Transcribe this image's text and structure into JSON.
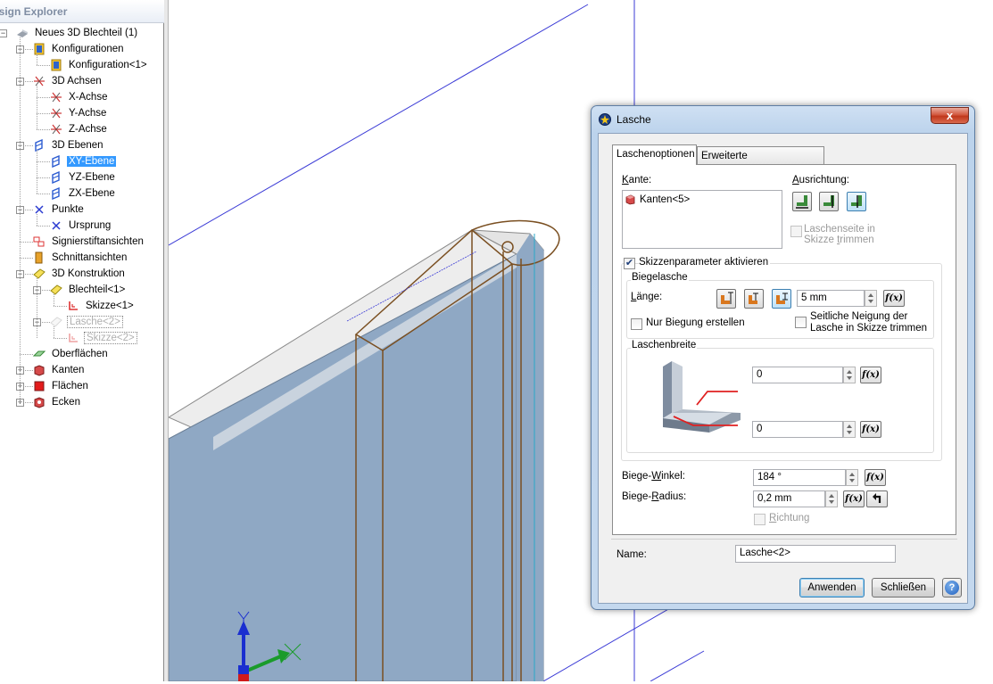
{
  "explorer": {
    "title": "esign Explorer",
    "items": [
      {
        "label": "Neues 3D Blechteil (1)",
        "icon": "sheetmetal-part-icon"
      },
      {
        "label": "Konfigurationen",
        "icon": "configurations-icon"
      },
      {
        "label": "Konfiguration<1>",
        "icon": "configuration-icon"
      },
      {
        "label": "3D Achsen",
        "icon": "axes-icon"
      },
      {
        "label": "X-Achse",
        "icon": "axis-icon"
      },
      {
        "label": "Y-Achse",
        "icon": "axis-icon"
      },
      {
        "label": "Z-Achse",
        "icon": "axis-icon"
      },
      {
        "label": "3D Ebenen",
        "icon": "planes-icon"
      },
      {
        "label": "XY-Ebene",
        "icon": "plane-icon"
      },
      {
        "label": "YZ-Ebene",
        "icon": "plane-icon"
      },
      {
        "label": "ZX-Ebene",
        "icon": "plane-icon"
      },
      {
        "label": "Punkte",
        "icon": "points-icon"
      },
      {
        "label": "Ursprung",
        "icon": "origin-icon"
      },
      {
        "label": "Signierstiftansichten",
        "icon": "marker-views-icon"
      },
      {
        "label": "Schnittansichten",
        "icon": "section-views-icon"
      },
      {
        "label": "3D Konstruktion",
        "icon": "construction-icon"
      },
      {
        "label": "Blechteil<1>",
        "icon": "sheetmetal-icon"
      },
      {
        "label": "Skizze<1>",
        "icon": "sketch-icon"
      },
      {
        "label": "Lasche<2>",
        "icon": "flange-icon"
      },
      {
        "label": "Skizze<2>",
        "icon": "sketch-icon"
      },
      {
        "label": "Oberflächen",
        "icon": "surfaces-icon"
      },
      {
        "label": "Kanten",
        "icon": "edges-icon"
      },
      {
        "label": "Flächen",
        "icon": "faces-icon"
      },
      {
        "label": "Ecken",
        "icon": "corners-icon"
      }
    ]
  },
  "dialog": {
    "title": "Lasche",
    "close_label": "x",
    "tabs": [
      "Laschenoptionen",
      "Erweiterte Laschenoptionen"
    ],
    "kante": {
      "label_pre": "K",
      "label_post": "ante:",
      "items": [
        "Kanten<5>"
      ]
    },
    "ausrichtung": {
      "label_pre": "A",
      "label_post": "usrichtung:",
      "trim_line1": "Laschenseite in",
      "trim_line2_pre": "Skizze ",
      "trim_line2_u": "t",
      "trim_line2_post": "rimmen"
    },
    "skizzen_param": {
      "label": "Skizzenparameter aktivieren",
      "checked": true
    },
    "biegelasche": {
      "title": "Biegelasche",
      "laenge_pre": "L",
      "laenge_post": "änge:",
      "laenge_value": "5 mm",
      "nur_biegung": "Nur Biegung erstellen",
      "seitliche_line1": "Seitliche Neigung der",
      "seitliche_line2": "Lasche in Skizze trimmen"
    },
    "laschenbreite": {
      "title": "Laschenbreite",
      "value1": "0",
      "value2": "0"
    },
    "biege_winkel": {
      "label_pre": "Biege-",
      "label_u": "W",
      "label_post": "inkel:",
      "value": "184 °"
    },
    "biege_radius": {
      "label_pre": "Biege-",
      "label_u": "R",
      "label_post": "adius:",
      "value": "0,2 mm"
    },
    "richtung": {
      "label_u": "R",
      "label_post": "ichtung"
    },
    "name": {
      "label": "Name:",
      "value": "Lasche<2>"
    },
    "buttons": {
      "apply": "Anwenden",
      "close": "Schließen",
      "help": "?"
    },
    "fx_label": "f(x)"
  },
  "viewport": {
    "triad_y_label": "Y"
  }
}
